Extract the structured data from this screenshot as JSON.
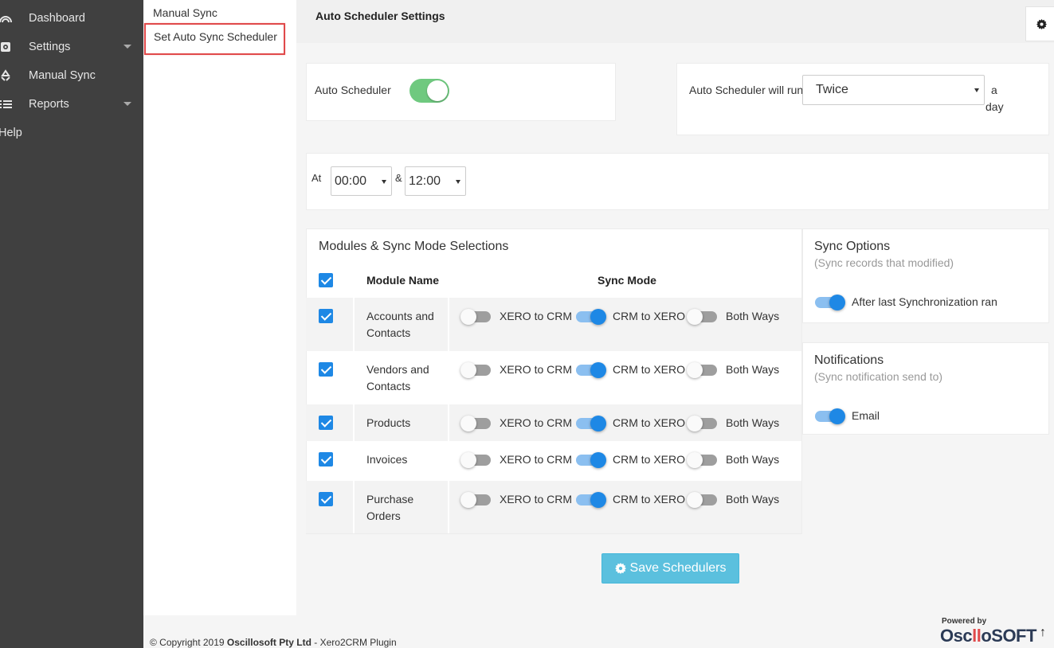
{
  "sidebar": {
    "items": [
      {
        "label": "Dashboard",
        "icon": "dashboard-icon"
      },
      {
        "label": "Settings",
        "icon": "gear-icon"
      },
      {
        "label": "Manual Sync",
        "icon": "recycle-icon"
      },
      {
        "label": "Reports",
        "icon": "list-icon"
      },
      {
        "label": "Help"
      }
    ]
  },
  "submenu": {
    "items": [
      {
        "label": "Manual Sync"
      },
      {
        "label": "Set Auto Sync Scheduler"
      }
    ]
  },
  "header": {
    "title": "Auto Scheduler Settings",
    "settings_icon": "gear-icon"
  },
  "scheduler": {
    "auto_label": "Auto Scheduler",
    "auto_enabled": true,
    "run_label": "Auto Scheduler will run",
    "run_value": "Twice",
    "run_suffix_1": "a",
    "run_suffix_2": "day",
    "at_label": "At",
    "time1": "00:00",
    "amp": "&",
    "time2": "12:00"
  },
  "modules": {
    "title": "Modules & Sync Mode Selections",
    "col_module": "Module Name",
    "col_mode": "Sync Mode",
    "mode_labels": [
      "XERO to CRM",
      "CRM to XERO",
      "Both Ways"
    ],
    "rows": [
      {
        "name": "Accounts and Contacts",
        "checked": true,
        "mode": "CRM to XERO"
      },
      {
        "name": "Vendors and Contacts",
        "checked": true,
        "mode": "CRM to XERO"
      },
      {
        "name": "Products",
        "checked": true,
        "mode": "CRM to XERO"
      },
      {
        "name": "Invoices",
        "checked": true,
        "mode": "CRM to XERO"
      },
      {
        "name": "Purchase Orders",
        "checked": true,
        "mode": "CRM to XERO"
      }
    ]
  },
  "sync_options": {
    "title": "Sync Options",
    "subtitle": "(Sync records that modified)",
    "option_label": "After last Synchronization ran",
    "option_on": true
  },
  "notifications": {
    "title": "Notifications",
    "subtitle": "(Sync notification send to)",
    "option_label": "Email",
    "option_on": true
  },
  "save_button": {
    "label": "Save Schedulers",
    "icon": "gear-icon",
    "color": "#5bc0de"
  },
  "footer": {
    "copyright": "© Copyright 2019",
    "company": "Oscillosoft Pty Ltd",
    "product": "- Xero2CRM Plugin",
    "powered_by": "Powered by",
    "brand_1": "Osc",
    "brand_2": "ll",
    "brand_3": "oSOFT",
    "to_top": "↑"
  },
  "colors": {
    "sidebar_bg": "#404040",
    "accent_blue": "#1e88e5",
    "toggle_green": "#6fc97f",
    "active_border": "#e0494a"
  }
}
